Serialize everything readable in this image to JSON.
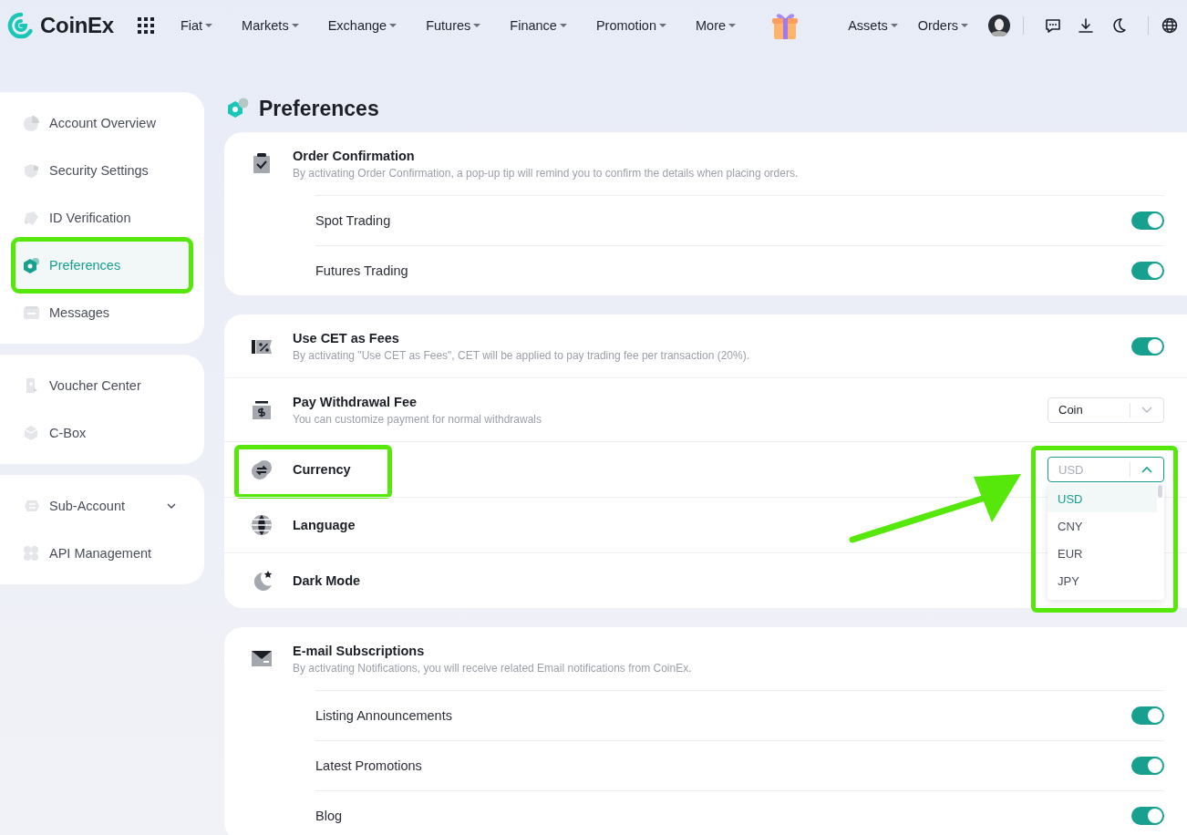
{
  "nav": {
    "logo": "CoinEx",
    "menus": [
      {
        "label": "Fiat"
      },
      {
        "label": "Markets"
      },
      {
        "label": "Exchange"
      },
      {
        "label": "Futures"
      },
      {
        "label": "Finance"
      },
      {
        "label": "Promotion"
      },
      {
        "label": "More"
      }
    ],
    "right_menus": [
      {
        "label": "Assets"
      },
      {
        "label": "Orders"
      }
    ]
  },
  "sidebar": {
    "groups": [
      {
        "items": [
          {
            "label": "Account Overview",
            "kind": "link",
            "selected": false,
            "highlighted": false
          },
          {
            "label": "Security Settings",
            "kind": "link",
            "selected": false,
            "highlighted": false
          },
          {
            "label": "ID Verification",
            "kind": "link",
            "selected": false,
            "highlighted": false
          },
          {
            "label": "Preferences",
            "kind": "link",
            "selected": true,
            "highlighted": true
          },
          {
            "label": "Messages",
            "kind": "link",
            "selected": false,
            "highlighted": false
          }
        ]
      },
      {
        "items": [
          {
            "label": "Voucher Center",
            "kind": "link",
            "selected": false,
            "highlighted": false
          },
          {
            "label": "C-Box",
            "kind": "link",
            "selected": false,
            "highlighted": false
          }
        ]
      },
      {
        "items": [
          {
            "label": "Sub-Account",
            "kind": "group",
            "selected": false,
            "highlighted": false
          },
          {
            "label": "API Management",
            "kind": "link",
            "selected": false,
            "highlighted": false
          }
        ]
      }
    ]
  },
  "page_title": "Preferences",
  "sections": [
    {
      "kind": "toggle-group",
      "title": "Order Confirmation",
      "description": "By activating Order Confirmation, a pop-up tip will remind you to confirm the details when placing orders.",
      "options": [
        {
          "label": "Spot Trading",
          "on": true
        },
        {
          "label": "Futures Trading",
          "on": true
        }
      ]
    },
    {
      "kind": "rows",
      "rows": [
        {
          "title": "Use CET as Fees",
          "description": "By activating \"Use CET as Fees\", CET will be applied to pay trading fee per transaction (20%).",
          "highlighted": false,
          "control": {
            "kind": "toggle",
            "on": true
          }
        },
        {
          "title": "Pay Withdrawal Fee",
          "description": "You can customize payment for normal withdrawals",
          "highlighted": false,
          "control": {
            "kind": "select",
            "value": "Coin",
            "open": false,
            "highlighted": false
          }
        },
        {
          "title": "Currency",
          "highlighted": true,
          "control": {
            "kind": "select",
            "value": "USD",
            "open": true,
            "highlighted": true,
            "options": [
              {
                "label": "USD",
                "selected": true
              },
              {
                "label": "CNY",
                "selected": false
              },
              {
                "label": "EUR",
                "selected": false
              },
              {
                "label": "JPY",
                "selected": false
              }
            ]
          }
        },
        {
          "title": "Language",
          "highlighted": false
        },
        {
          "title": "Dark Mode",
          "highlighted": false
        }
      ]
    },
    {
      "kind": "toggle-group",
      "title": "E-mail Subscriptions",
      "description": "By activating Notifications, you will receive related Email notifications from CoinEx.",
      "options": [
        {
          "label": "Listing Announcements",
          "on": true
        },
        {
          "label": "Latest Promotions",
          "on": true
        },
        {
          "label": "Blog",
          "on": true
        }
      ]
    }
  ],
  "pointer_arrow": true
}
